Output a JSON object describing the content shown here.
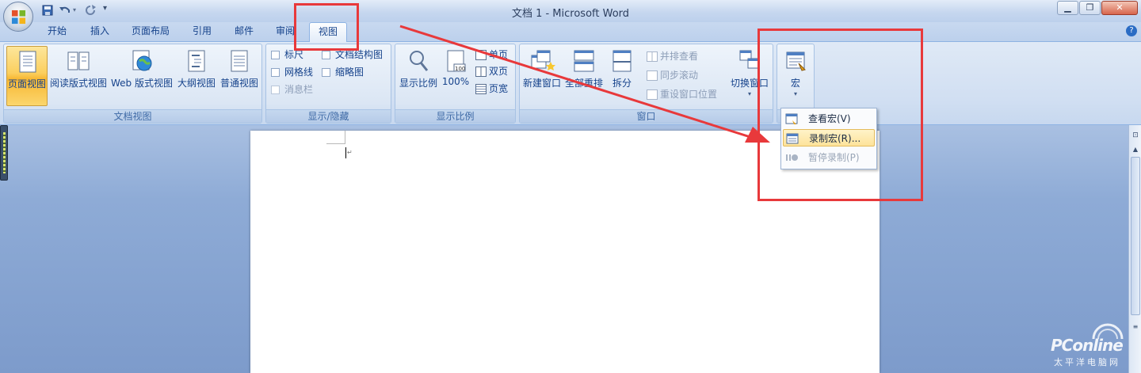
{
  "window": {
    "title": "文档 1 - Microsoft Word",
    "controls": [
      "minimize",
      "restore",
      "close"
    ]
  },
  "quick_access": {
    "icons": [
      "save-icon",
      "undo-icon",
      "redo-icon",
      "customize-icon"
    ]
  },
  "tabs": [
    {
      "label": "开始"
    },
    {
      "label": "插入"
    },
    {
      "label": "页面布局"
    },
    {
      "label": "引用"
    },
    {
      "label": "邮件"
    },
    {
      "label": "审阅"
    },
    {
      "label": "视图",
      "active": true
    }
  ],
  "groups": {
    "views": {
      "label": "文档视图",
      "buttons": [
        {
          "label": "页面视图",
          "active": true
        },
        {
          "label": "阅读版式视图"
        },
        {
          "label": "Web 版式视图"
        },
        {
          "label": "大纲视图"
        },
        {
          "label": "普通视图"
        }
      ]
    },
    "show_hide": {
      "label": "显示/隐藏",
      "items": [
        {
          "label": "标尺",
          "checked": false
        },
        {
          "label": "网格线",
          "checked": false
        },
        {
          "label": "消息栏",
          "checked": false,
          "disabled": true
        },
        {
          "label": "文档结构图",
          "checked": false
        },
        {
          "label": "缩略图",
          "checked": false
        }
      ]
    },
    "zoom": {
      "label": "显示比例",
      "zoom_label": "显示比例",
      "percent_label": "100%",
      "one_page": "单页",
      "two_pages": "双页",
      "page_width": "页宽"
    },
    "window": {
      "label": "窗口",
      "new_window": "新建窗口",
      "arrange_all": "全部重排",
      "split": "拆分",
      "side_by_side": "并排查看",
      "sync_scroll": "同步滚动",
      "reset_position": "重设窗口位置",
      "switch_windows": "切换窗口"
    },
    "macros": {
      "label": "宏"
    }
  },
  "macro_menu": {
    "items": [
      {
        "label": "查看宏(V)",
        "state": "normal"
      },
      {
        "label": "录制宏(R)...",
        "state": "hover"
      },
      {
        "label": "暂停录制(P)",
        "state": "disabled"
      }
    ]
  },
  "watermark": {
    "brand": "PConline",
    "subtitle": "太平洋电脑网"
  },
  "colors": {
    "annotation_red": "#e8393b",
    "ribbon_text": "#15428b",
    "active_button_gold": "#f7b733"
  }
}
